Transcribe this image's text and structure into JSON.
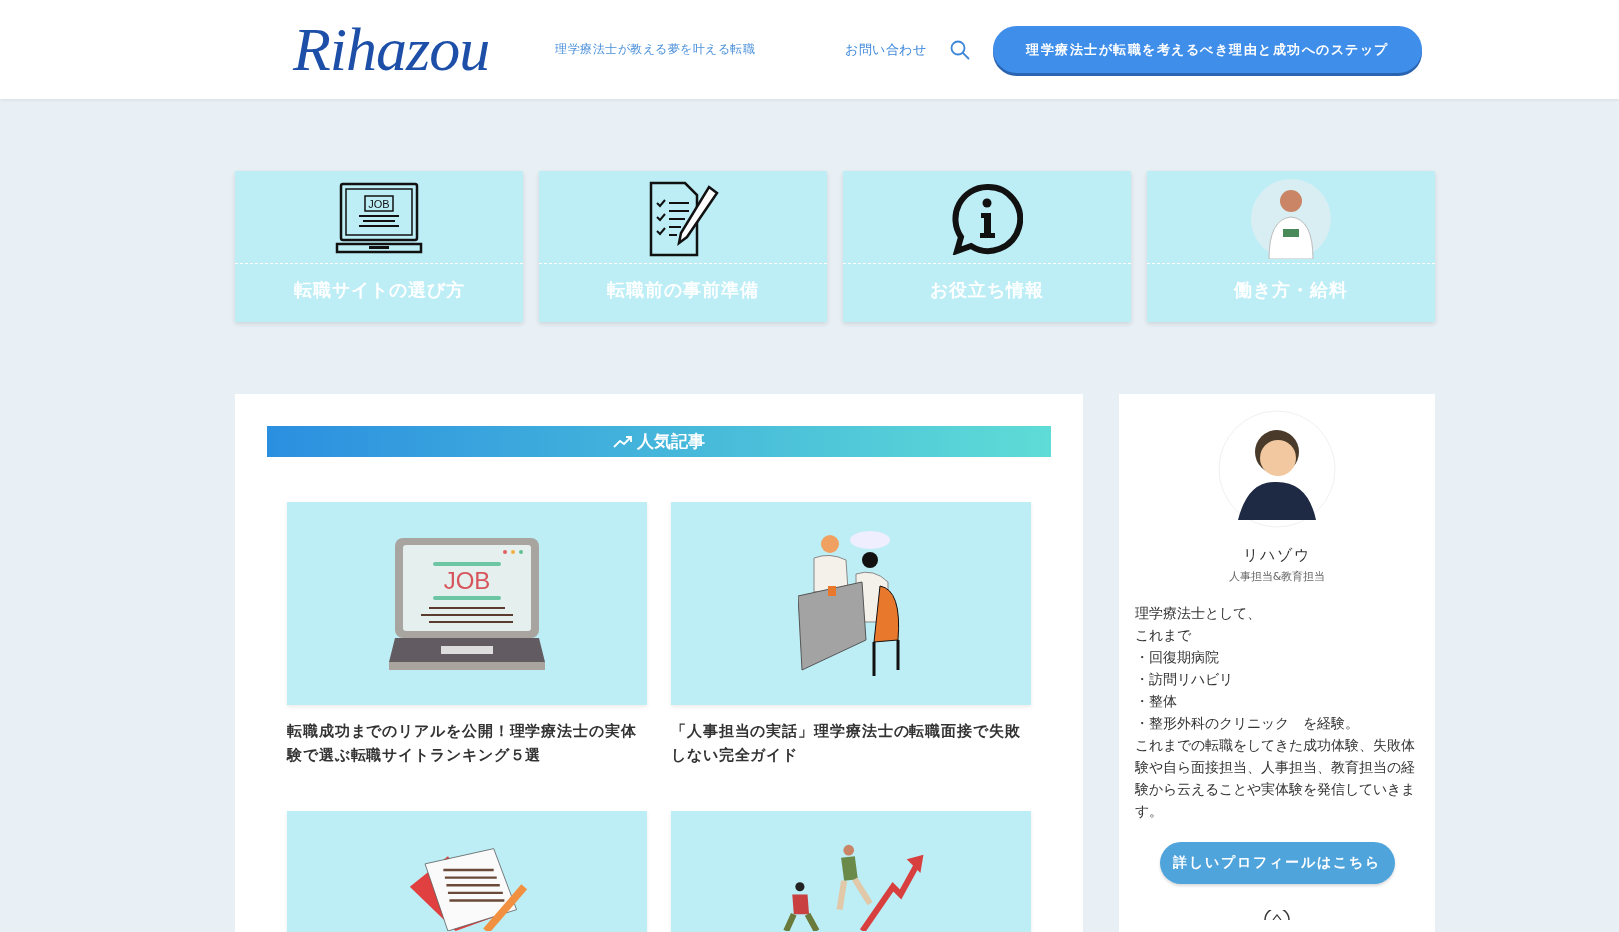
{
  "header": {
    "logo": "Rihazou",
    "tagline": "理学療法士が教える夢を叶える転職",
    "contact_link": "お問い合わせ",
    "cta_button": "理学療法士が転職を考えるべき理由と成功へのステップ"
  },
  "categories": [
    {
      "kind": "laptop",
      "screen_text": "JOB",
      "label": "転職サイトの選び方"
    },
    {
      "kind": "checklist",
      "label": "転職前の事前準備"
    },
    {
      "kind": "info",
      "label": "お役立ち情報"
    },
    {
      "kind": "person",
      "label": "働き方・給料"
    }
  ],
  "popular": {
    "heading": "人気記事",
    "articles": [
      {
        "kind": "laptop",
        "screen_text": "JOB",
        "title": "転職成功までのリアルを公開！理学療法士の実体験で選ぶ転職サイトランキング５選"
      },
      {
        "kind": "interview",
        "title": "「人事担当の実話」理学療法士の転職面接で失敗しない完全ガイド"
      },
      {
        "kind": "documents"
      },
      {
        "kind": "growth"
      }
    ]
  },
  "profile": {
    "name": "リハゾウ",
    "role": "人事担当&教育担当",
    "bio": [
      "理学療法士として、",
      "これまで",
      "・回復期病院",
      "・訪問リハビリ",
      "・整体",
      "・整形外科のクリニック　を経験。",
      "これまでの転職をしてきた成功体験、失敗体験や自ら面接担当、人事担当、教育担当の経験から云えることや実体験を発信していきます。"
    ],
    "button": "詳しいプロフィールはこちら"
  }
}
